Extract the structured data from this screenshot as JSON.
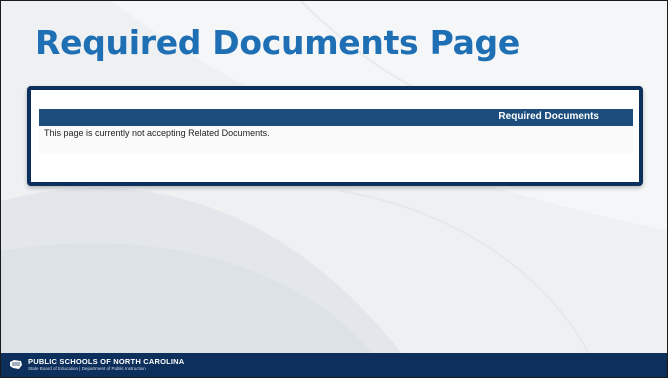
{
  "slide": {
    "title": "Required Documents Page"
  },
  "screenshot": {
    "header_label": "Required Documents",
    "message": "This page is currently not accepting Related Documents."
  },
  "footer": {
    "organization": "PUBLIC SCHOOLS OF NORTH CAROLINA",
    "subtitle": "State Board of Education | Department of Public Instruction",
    "logo_icon": "nc-map-logo-icon"
  },
  "colors": {
    "title": "#1f6fb5",
    "frame_border": "#0d2f5c",
    "panel_header": "#1c4d7d",
    "footer": "#0d2f5c",
    "background": "#eef0f2"
  }
}
